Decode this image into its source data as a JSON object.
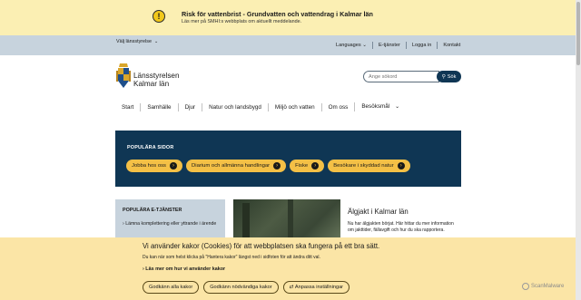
{
  "alert": {
    "title": "Risk för vattenbrist - Grundvatten och vattendrag i Kalmar län",
    "subtitle": "Läs mer på SMHI:s webbplats om aktuellt meddelande.",
    "icon_char": "!"
  },
  "topbar": {
    "region_select": "Välj länsstyrelse",
    "links": [
      "Languages",
      "E-tjänster",
      "Logga in",
      "Kontakt"
    ]
  },
  "brand": {
    "line1": "Länsstyrelsen",
    "line2": "Kalmar län"
  },
  "search": {
    "placeholder": "Ange sökord",
    "button_label": "Sök"
  },
  "nav": {
    "items": [
      "Start",
      "Samhälle",
      "Djur",
      "Natur och landsbygd",
      "Miljö och vatten",
      "Om oss",
      "Besöksmål"
    ]
  },
  "popular": {
    "title": "POPULÄRA SIDOR",
    "chips": [
      "Jobba hos oss",
      "Diarium och allmänna handlingar",
      "Fiske",
      "Besökare i skyddad natur"
    ]
  },
  "eservices": {
    "title": "POPULÄRA E-TJÄNSTER",
    "link": "Lämna komplettering eller yttrande i ärende"
  },
  "article": {
    "title": "Älgjakt i Kalmar län",
    "text": "Nu har älgjakten börjat. Här hittar du mer information om jakttider, fällavgift och hur du ska rapportera."
  },
  "cookie": {
    "title": "Vi använder kakor (Cookies) för att webbplatsen ska fungera på ett bra sätt.",
    "subtitle": "Du kan när som helst klicka på \"Hantera kakor\" längst ned i sidfoten för att ändra ditt val.",
    "link": "Läs mer om hur vi använder kakor",
    "buttons": [
      "Godkänn alla kakor",
      "Godkänn nödvändiga kakor",
      "Anpassa inställningar"
    ]
  },
  "watermark": "ScanMalware",
  "colors": {
    "alert_bg": "#fbefb3",
    "topbar_bg": "#c7d3dd",
    "brand_dark": "#0f3654",
    "chip_yellow": "#f4c046",
    "cookie_bg": "#fbe5a6"
  }
}
